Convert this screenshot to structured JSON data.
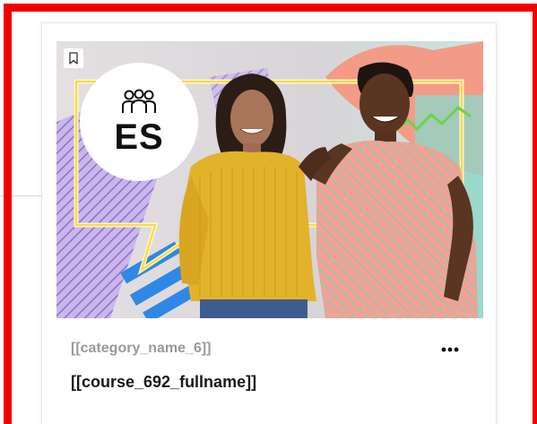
{
  "card": {
    "badge_text": "ES",
    "category": "[[category_name_6]]",
    "title": "[[course_692_fullname]]",
    "icons": {
      "bookmark": "bookmark-icon",
      "group": "group-icon",
      "more": "more-options-icon"
    }
  },
  "colors": {
    "frame": "#f20000",
    "category_text": "#9a9a9a",
    "title_text": "#1a1a1a"
  }
}
